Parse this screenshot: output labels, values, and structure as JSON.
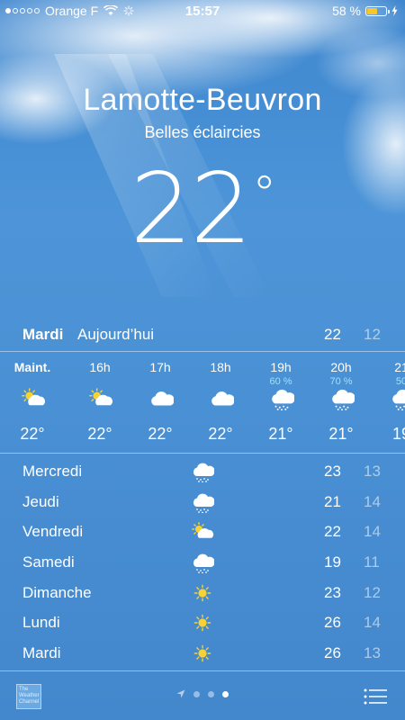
{
  "status_bar": {
    "carrier": "Orange F",
    "time": "15:57",
    "battery": "58 %",
    "battery_level": 0.58
  },
  "location": {
    "city": "Lamotte-Beuvron",
    "condition": "Belles éclaircies",
    "temperature": "22",
    "degree_symbol": "°"
  },
  "today": {
    "day": "Mardi",
    "label": "Aujourd’hui",
    "high": "22",
    "low": "12"
  },
  "hourly": [
    {
      "hour": "Maint.",
      "precip": "",
      "icon": "partly-sunny-icon",
      "temp": "22°"
    },
    {
      "hour": "16h",
      "precip": "",
      "icon": "partly-sunny-icon",
      "temp": "22°"
    },
    {
      "hour": "17h",
      "precip": "",
      "icon": "cloud-icon",
      "temp": "22°"
    },
    {
      "hour": "18h",
      "precip": "",
      "icon": "cloud-icon",
      "temp": "22°"
    },
    {
      "hour": "19h",
      "precip": "60 %",
      "icon": "rain-cloud-icon",
      "temp": "21°"
    },
    {
      "hour": "20h",
      "precip": "70 %",
      "icon": "rain-cloud-icon",
      "temp": "21°"
    },
    {
      "hour": "21",
      "precip": "50",
      "icon": "rain-cloud-icon",
      "temp": "19"
    }
  ],
  "daily": [
    {
      "day": "Mercredi",
      "icon": "rain-cloud-icon",
      "high": "23",
      "low": "13"
    },
    {
      "day": "Jeudi",
      "icon": "rain-cloud-icon",
      "high": "21",
      "low": "14"
    },
    {
      "day": "Vendredi",
      "icon": "partly-sunny-icon",
      "high": "22",
      "low": "14"
    },
    {
      "day": "Samedi",
      "icon": "rain-cloud-icon",
      "high": "19",
      "low": "11"
    },
    {
      "day": "Dimanche",
      "icon": "sun-icon",
      "high": "23",
      "low": "12"
    },
    {
      "day": "Lundi",
      "icon": "sun-icon",
      "high": "26",
      "low": "14"
    },
    {
      "day": "Mardi",
      "icon": "sun-icon",
      "high": "26",
      "low": "13"
    }
  ],
  "bottom_bar": {
    "logo_text": "The Weather Channel",
    "pages": 3,
    "active_page": 3
  },
  "colors": {
    "sky": "#4a90d4",
    "sun": "#f8d233",
    "precip": "#9ee0ff"
  }
}
